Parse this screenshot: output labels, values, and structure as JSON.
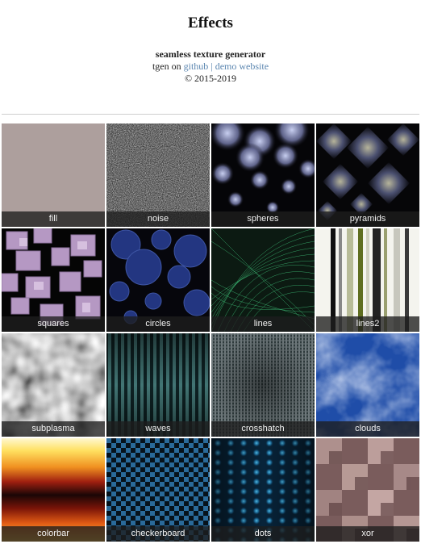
{
  "header": {
    "title": "Effects",
    "subtitle": "seamless texture generator",
    "prefix": "tgen on ",
    "github_link": "github",
    "separator": " | ",
    "demo_link": "demo website",
    "copyright": "© 2015-2019"
  },
  "effects": [
    {
      "label": "fill"
    },
    {
      "label": "noise"
    },
    {
      "label": "spheres"
    },
    {
      "label": "pyramids"
    },
    {
      "label": "squares"
    },
    {
      "label": "circles"
    },
    {
      "label": "lines"
    },
    {
      "label": "lines2"
    },
    {
      "label": "subplasma"
    },
    {
      "label": "waves"
    },
    {
      "label": "crosshatch"
    },
    {
      "label": "clouds"
    },
    {
      "label": "colorbar"
    },
    {
      "label": "checkerboard"
    },
    {
      "label": "dots"
    },
    {
      "label": "xor"
    }
  ]
}
